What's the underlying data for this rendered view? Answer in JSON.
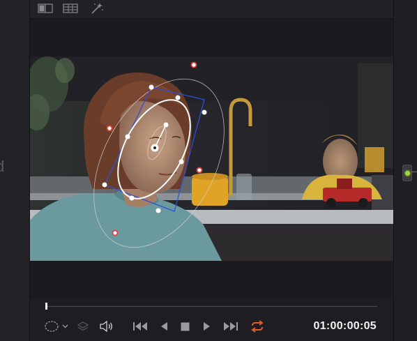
{
  "left_panel": {
    "cut_letter": "d"
  },
  "toolbar": {
    "buttons": [
      {
        "icon": "dual-viewer-icon"
      },
      {
        "icon": "grid-layout-icon"
      },
      {
        "icon": "magic-wand-icon"
      }
    ]
  },
  "viewer": {
    "window_type": "ellipse",
    "colors": {
      "inner_ring": "#ffffff",
      "outer_ring": "#cfcfcf",
      "handles_red": "#e0403a",
      "bounding_box": "#2f50d8"
    }
  },
  "transport": {
    "timecode": "01:00:00:05",
    "loop_color": "#e05a2a",
    "controls": [
      {
        "icon": "window-shape-icon"
      },
      {
        "icon": "layers-icon"
      },
      {
        "icon": "speaker-icon"
      },
      {
        "icon": "jump-to-start-icon"
      },
      {
        "icon": "reverse-play-icon"
      },
      {
        "icon": "stop-icon"
      },
      {
        "icon": "play-icon"
      },
      {
        "icon": "jump-to-end-icon"
      },
      {
        "icon": "loop-icon"
      }
    ]
  },
  "node": {
    "status_color": "#a6d33a"
  }
}
